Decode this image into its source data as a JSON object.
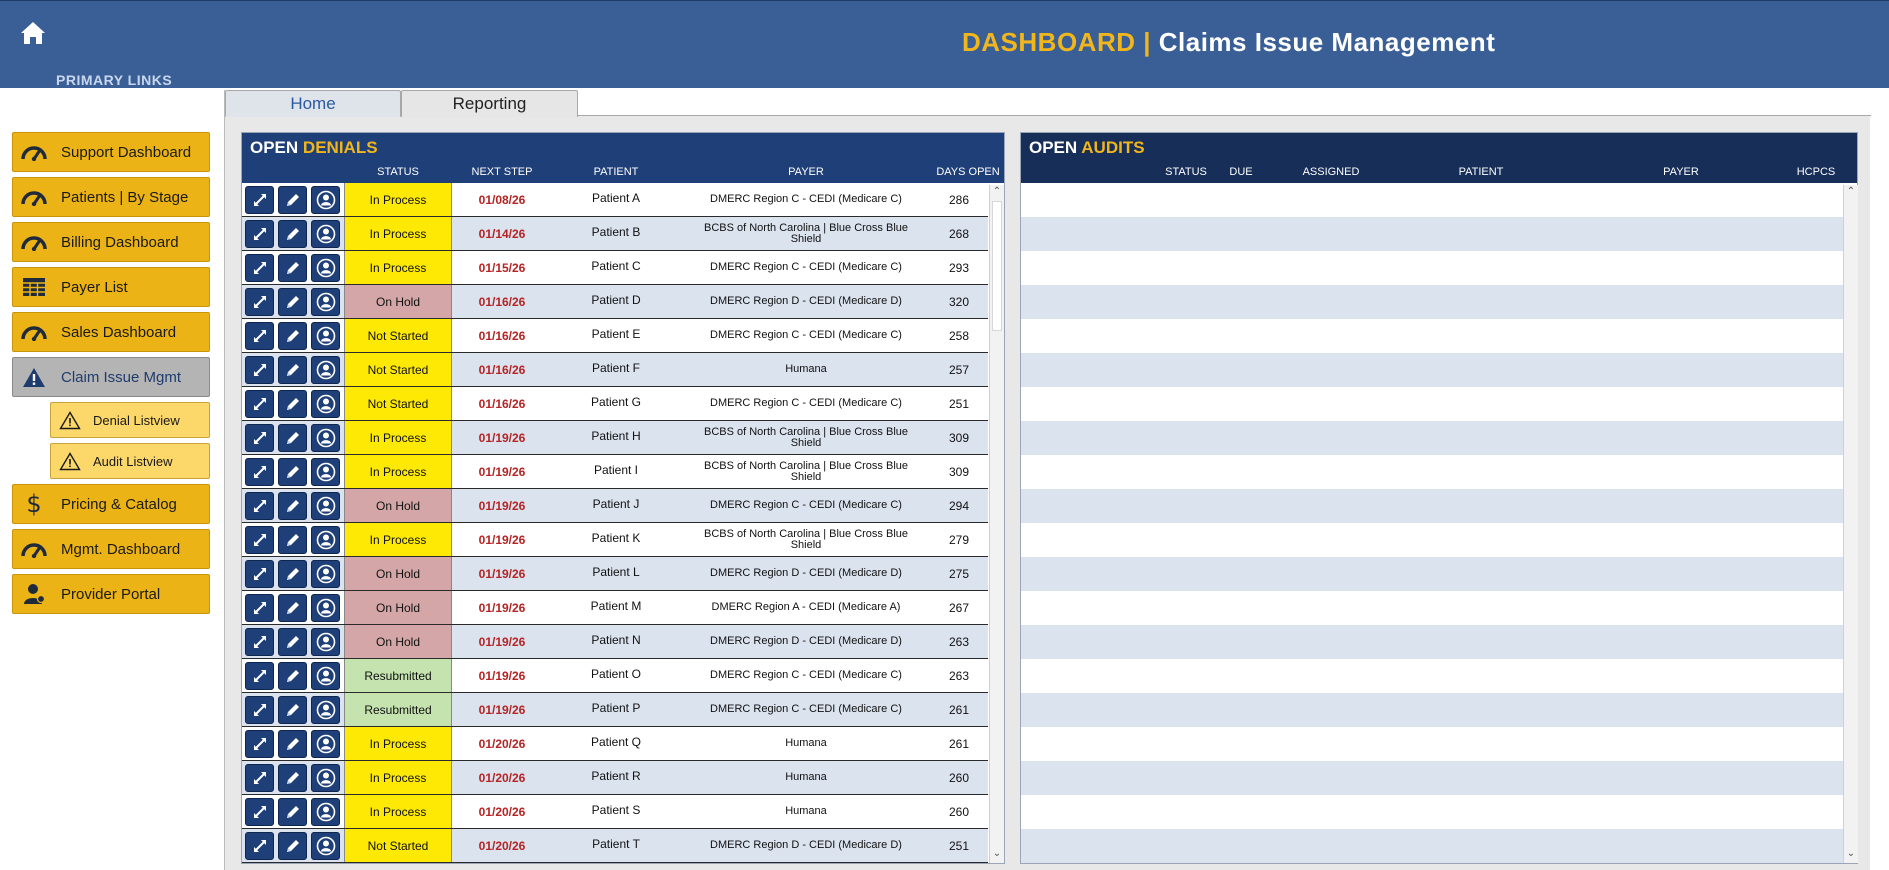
{
  "header": {
    "title_accent": "DASHBOARD |",
    "title_main": "Claims Issue Management",
    "primary_links": "PRIMARY LINKS"
  },
  "sidebar": {
    "items": [
      {
        "label": "Support Dashboard",
        "icon": "speedometer-icon"
      },
      {
        "label": "Patients | By Stage",
        "icon": "speedometer-icon"
      },
      {
        "label": "Billing Dashboard",
        "icon": "speedometer-icon"
      },
      {
        "label": "Payer List",
        "icon": "table-icon"
      },
      {
        "label": "Sales Dashboard",
        "icon": "speedometer-icon"
      },
      {
        "label": "Claim Issue Mgmt",
        "icon": "warning-icon",
        "active": true
      },
      {
        "label": "Denial Listview",
        "icon": "warning-icon",
        "sub": true
      },
      {
        "label": "Audit Listview",
        "icon": "warning-icon",
        "sub": true
      },
      {
        "label": "Pricing & Catalog",
        "icon": "dollar-icon"
      },
      {
        "label": "Mgmt. Dashboard",
        "icon": "speedometer-icon"
      },
      {
        "label": "Provider Portal",
        "icon": "user-icon"
      }
    ]
  },
  "tabs": {
    "home": "Home",
    "reporting": "Reporting"
  },
  "denials": {
    "title_open": "OPEN",
    "title_accent": "DENIALS",
    "columns": {
      "status": "STATUS",
      "next_step": "NEXT STEP",
      "patient": "PATIENT",
      "payer": "PAYER",
      "days_open": "DAYS OPEN"
    },
    "rows": [
      {
        "status": "In Process",
        "next": "01/08/26",
        "patient": "Patient A",
        "payer": "DMERC Region C - CEDI (Medicare C)",
        "days": "286"
      },
      {
        "status": "In Process",
        "next": "01/14/26",
        "patient": "Patient B",
        "payer": "BCBS of North Carolina | Blue Cross Blue Shield",
        "days": "268"
      },
      {
        "status": "In Process",
        "next": "01/15/26",
        "patient": "Patient C",
        "payer": "DMERC Region C - CEDI (Medicare C)",
        "days": "293"
      },
      {
        "status": "On Hold",
        "next": "01/16/26",
        "patient": "Patient D",
        "payer": "DMERC Region D - CEDI (Medicare D)",
        "days": "320"
      },
      {
        "status": "Not Started",
        "next": "01/16/26",
        "patient": "Patient E",
        "payer": "DMERC Region C - CEDI (Medicare C)",
        "days": "258"
      },
      {
        "status": "Not Started",
        "next": "01/16/26",
        "patient": "Patient F",
        "payer": "Humana",
        "days": "257"
      },
      {
        "status": "Not Started",
        "next": "01/16/26",
        "patient": "Patient G",
        "payer": "DMERC Region C - CEDI (Medicare C)",
        "days": "251"
      },
      {
        "status": "In Process",
        "next": "01/19/26",
        "patient": "Patient H",
        "payer": "BCBS of North Carolina | Blue Cross Blue Shield",
        "days": "309"
      },
      {
        "status": "In Process",
        "next": "01/19/26",
        "patient": "Patient I",
        "payer": "BCBS of North Carolina | Blue Cross Blue Shield",
        "days": "309"
      },
      {
        "status": "On Hold",
        "next": "01/19/26",
        "patient": "Patient J",
        "payer": "DMERC Region C - CEDI (Medicare C)",
        "days": "294"
      },
      {
        "status": "In Process",
        "next": "01/19/26",
        "patient": "Patient K",
        "payer": "BCBS of North Carolina | Blue Cross Blue Shield",
        "days": "279"
      },
      {
        "status": "On Hold",
        "next": "01/19/26",
        "patient": "Patient L",
        "payer": "DMERC Region D - CEDI (Medicare D)",
        "days": "275"
      },
      {
        "status": "On Hold",
        "next": "01/19/26",
        "patient": "Patient M",
        "payer": "DMERC Region A - CEDI (Medicare A)",
        "days": "267"
      },
      {
        "status": "On Hold",
        "next": "01/19/26",
        "patient": "Patient N",
        "payer": "DMERC Region D - CEDI (Medicare D)",
        "days": "263"
      },
      {
        "status": "Resubmitted",
        "next": "01/19/26",
        "patient": "Patient O",
        "payer": "DMERC Region C - CEDI (Medicare C)",
        "days": "263"
      },
      {
        "status": "Resubmitted",
        "next": "01/19/26",
        "patient": "Patient P",
        "payer": "DMERC Region C - CEDI (Medicare C)",
        "days": "261"
      },
      {
        "status": "In Process",
        "next": "01/20/26",
        "patient": "Patient Q",
        "payer": "Humana",
        "days": "261"
      },
      {
        "status": "In Process",
        "next": "01/20/26",
        "patient": "Patient R",
        "payer": "Humana",
        "days": "260"
      },
      {
        "status": "In Process",
        "next": "01/20/26",
        "patient": "Patient S",
        "payer": "Humana",
        "days": "260"
      },
      {
        "status": "Not Started",
        "next": "01/20/26",
        "patient": "Patient T",
        "payer": "DMERC Region D - CEDI (Medicare D)",
        "days": "251"
      }
    ]
  },
  "audits": {
    "title_open": "OPEN",
    "title_accent": "AUDITS",
    "columns": {
      "status": "STATUS",
      "due": "DUE",
      "assigned": "ASSIGNED",
      "patient": "PATIENT",
      "payer": "PAYER",
      "hcpcs": "HCPCS"
    }
  },
  "colors": {
    "header_bg": "#3a5f96",
    "accent": "#f1b61c",
    "nav_bg": "#ecb317",
    "panel_head": "#1f3f78",
    "in_process": "#fde904",
    "on_hold": "#d4a6a8",
    "resubmitted": "#c4e3ae",
    "next_step": "#b52323"
  }
}
